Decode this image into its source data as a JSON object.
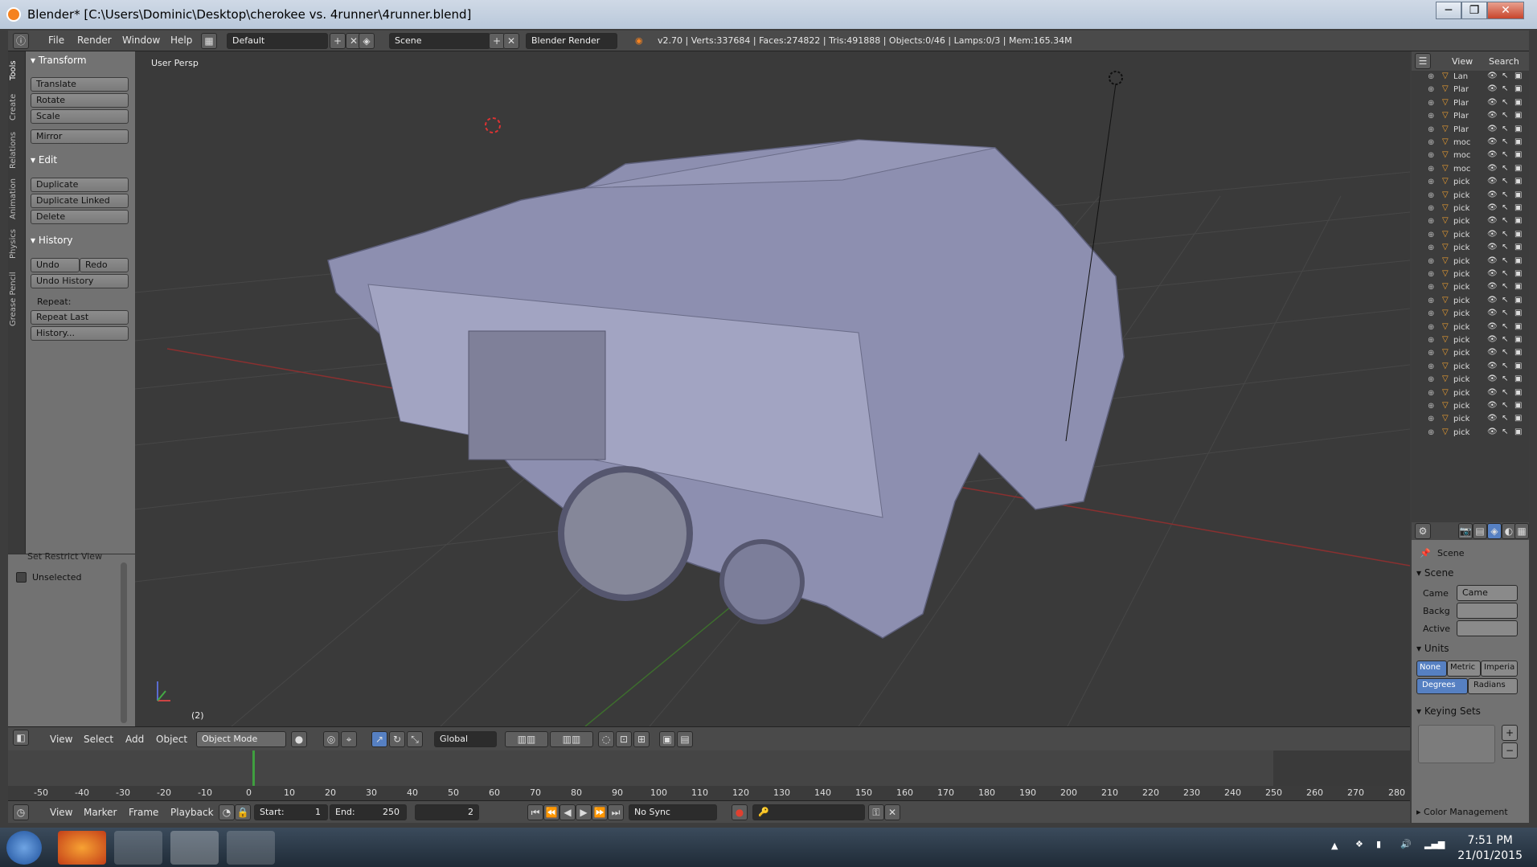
{
  "window": {
    "title": "Blender* [C:\\Users\\Dominic\\Desktop\\cherokee vs. 4runner\\4runner.blend]",
    "minimize": "─",
    "maximize": "❐",
    "close": "✕"
  },
  "topbar": {
    "menus": [
      "File",
      "Render",
      "Window",
      "Help"
    ],
    "screen_layout": "Default",
    "scene": "Scene",
    "engine": "Blender Render",
    "stats": "v2.70 | Verts:337684 | Faces:274822 | Tris:491888 | Objects:0/46 | Lamps:0/3 | Mem:165.34M"
  },
  "toolshelf": {
    "tabs": [
      "Tools",
      "Create",
      "Relations",
      "Animation",
      "Physics",
      "Grease Pencil"
    ],
    "transform": {
      "header": "Transform",
      "buttons": [
        "Translate",
        "Rotate",
        "Scale"
      ],
      "mirror": "Mirror"
    },
    "edit": {
      "header": "Edit",
      "buttons": [
        "Duplicate",
        "Duplicate Linked",
        "Delete"
      ]
    },
    "history": {
      "header": "History",
      "undo": "Undo",
      "redo": "Redo",
      "undo_history": "Undo History",
      "repeat_label": "Repeat:",
      "repeat_last": "Repeat Last",
      "history_btn": "History..."
    }
  },
  "lower_panel": {
    "header": "Set Restrict View",
    "checkbox": "Unselected"
  },
  "viewport": {
    "label": "User Persp",
    "frame_indicator": "(2)"
  },
  "view3d_header": {
    "menus": [
      "View",
      "Select",
      "Add",
      "Object"
    ],
    "mode": "Object Mode",
    "orientation": "Global"
  },
  "timeline": {
    "ticks": [
      "-50",
      "-40",
      "-30",
      "-20",
      "-10",
      "0",
      "10",
      "20",
      "30",
      "40",
      "50",
      "60",
      "70",
      "80",
      "90",
      "100",
      "110",
      "120",
      "130",
      "140",
      "150",
      "160",
      "170",
      "180",
      "190",
      "200",
      "210",
      "220",
      "230",
      "240",
      "250",
      "260",
      "270",
      "280"
    ],
    "menus": [
      "View",
      "Marker",
      "Frame",
      "Playback"
    ],
    "start_label": "Start:",
    "start_value": "1",
    "end_label": "End:",
    "end_value": "250",
    "current": "2",
    "sync": "No Sync"
  },
  "outliner": {
    "view": "View",
    "search": "Search",
    "rows": [
      "Lan",
      "Plar",
      "Plar",
      "Plar",
      "Plar",
      "moc",
      "moc",
      "moc",
      "pick",
      "pick",
      "pick",
      "pick",
      "pick",
      "pick",
      "pick",
      "pick",
      "pick",
      "pick",
      "pick",
      "pick",
      "pick",
      "pick",
      "pick",
      "pick",
      "pick",
      "pick",
      "pick",
      "pick"
    ]
  },
  "properties": {
    "breadcrumb": "Scene",
    "scene_header": "Scene",
    "camera_label": "Came",
    "camera_value": "Came",
    "background_label": "Backg",
    "active_label": "Active",
    "units_header": "Units",
    "unit_systems": [
      "None",
      "Metric",
      "Imperia"
    ],
    "rotation_units": [
      "Degrees",
      "Radians"
    ],
    "keying_header": "Keying Sets",
    "color_mgmt": "Color Management"
  },
  "taskbar": {
    "time": "7:51 PM",
    "date": "21/01/2015"
  }
}
